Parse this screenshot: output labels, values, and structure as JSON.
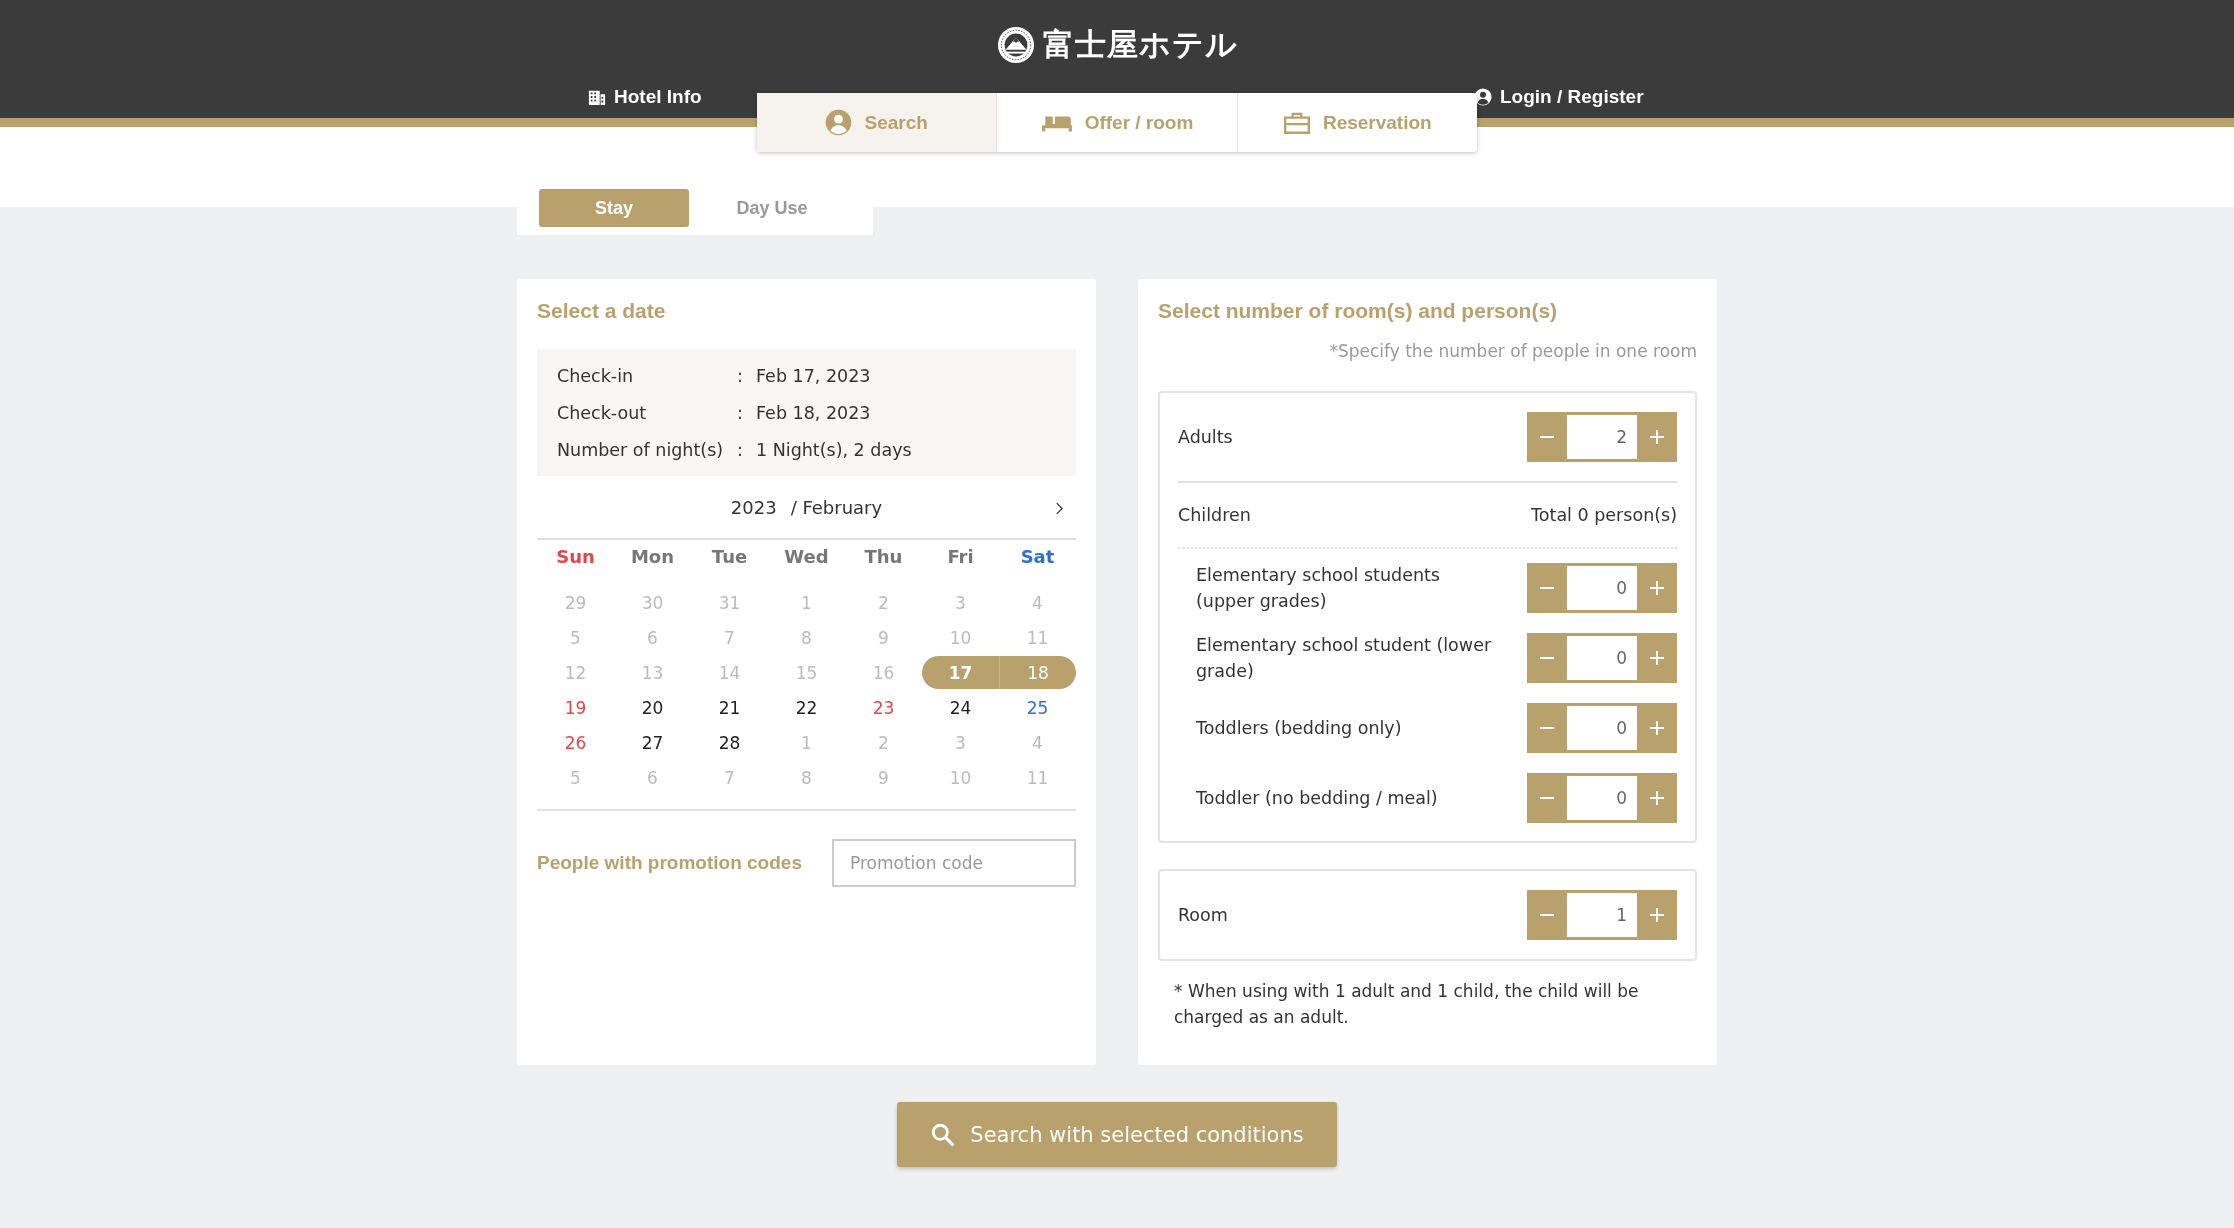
{
  "header": {
    "brand": "富士屋ホテル",
    "hotel_info": "Hotel Info",
    "login": "Login / Register"
  },
  "steps": [
    {
      "label": "Search",
      "selected": true
    },
    {
      "label": "Offer / room",
      "selected": false
    },
    {
      "label": "Reservation",
      "selected": false
    }
  ],
  "mode_tabs": [
    {
      "label": "Stay",
      "selected": true
    },
    {
      "label": "Day Use",
      "selected": false
    }
  ],
  "date_panel": {
    "title": "Select a date",
    "summary": [
      {
        "label": "Check-in",
        "value": "Feb 17, 2023"
      },
      {
        "label": "Check-out",
        "value": "Feb 18, 2023"
      },
      {
        "label": "Number of night(s)",
        "value": "1 Night(s), 2 days"
      }
    ],
    "separator": ":",
    "year": "2023",
    "month": "/ February",
    "weekdays": [
      {
        "label": "Sun",
        "kind": "red"
      },
      {
        "label": "Mon",
        "kind": "plain"
      },
      {
        "label": "Tue",
        "kind": "plain"
      },
      {
        "label": "Wed",
        "kind": "plain"
      },
      {
        "label": "Thu",
        "kind": "plain"
      },
      {
        "label": "Fri",
        "kind": "plain"
      },
      {
        "label": "Sat",
        "kind": "blue"
      }
    ],
    "weeks": [
      [
        {
          "label": "29",
          "kind": "muted",
          "selected": false
        },
        {
          "label": "30",
          "kind": "muted",
          "selected": false
        },
        {
          "label": "31",
          "kind": "muted",
          "selected": false
        },
        {
          "label": "1",
          "kind": "muted",
          "selected": false
        },
        {
          "label": "2",
          "kind": "muted",
          "selected": false
        },
        {
          "label": "3",
          "kind": "muted",
          "selected": false
        },
        {
          "label": "4",
          "kind": "muted",
          "selected": false
        }
      ],
      [
        {
          "label": "5",
          "kind": "muted",
          "selected": false
        },
        {
          "label": "6",
          "kind": "muted",
          "selected": false
        },
        {
          "label": "7",
          "kind": "muted",
          "selected": false
        },
        {
          "label": "8",
          "kind": "muted",
          "selected": false
        },
        {
          "label": "9",
          "kind": "muted",
          "selected": false
        },
        {
          "label": "10",
          "kind": "muted",
          "selected": false
        },
        {
          "label": "11",
          "kind": "muted",
          "selected": false
        }
      ],
      [
        {
          "label": "12",
          "kind": "muted",
          "selected": false
        },
        {
          "label": "13",
          "kind": "muted",
          "selected": false
        },
        {
          "label": "14",
          "kind": "muted",
          "selected": false
        },
        {
          "label": "15",
          "kind": "muted",
          "selected": false
        },
        {
          "label": "16",
          "kind": "muted",
          "selected": false
        },
        {
          "label": "17",
          "kind": "plain",
          "selected": true
        },
        {
          "label": "18",
          "kind": "blue",
          "selected": true
        }
      ],
      [
        {
          "label": "19",
          "kind": "red",
          "selected": false
        },
        {
          "label": "20",
          "kind": "plain",
          "selected": false
        },
        {
          "label": "21",
          "kind": "plain",
          "selected": false
        },
        {
          "label": "22",
          "kind": "plain",
          "selected": false
        },
        {
          "label": "23",
          "kind": "red",
          "selected": false
        },
        {
          "label": "24",
          "kind": "plain",
          "selected": false
        },
        {
          "label": "25",
          "kind": "blue",
          "selected": false
        }
      ],
      [
        {
          "label": "26",
          "kind": "red",
          "selected": false
        },
        {
          "label": "27",
          "kind": "plain",
          "selected": false
        },
        {
          "label": "28",
          "kind": "plain",
          "selected": false
        },
        {
          "label": "1",
          "kind": "muted",
          "selected": false
        },
        {
          "label": "2",
          "kind": "muted",
          "selected": false
        },
        {
          "label": "3",
          "kind": "muted",
          "selected": false
        },
        {
          "label": "4",
          "kind": "muted",
          "selected": false
        }
      ],
      [
        {
          "label": "5",
          "kind": "muted",
          "selected": false
        },
        {
          "label": "6",
          "kind": "muted",
          "selected": false
        },
        {
          "label": "7",
          "kind": "muted",
          "selected": false
        },
        {
          "label": "8",
          "kind": "muted",
          "selected": false
        },
        {
          "label": "9",
          "kind": "muted",
          "selected": false
        },
        {
          "label": "10",
          "kind": "muted",
          "selected": false
        },
        {
          "label": "11",
          "kind": "muted",
          "selected": false
        }
      ]
    ],
    "promo_label": "People with promotion codes",
    "promo_placeholder": "Promotion code"
  },
  "guest_panel": {
    "title": "Select number of room(s) and person(s)",
    "note": "*Specify the number of people in one room",
    "adults": {
      "label": "Adults",
      "value": "2"
    },
    "children": {
      "label": "Children",
      "total": "Total 0 person(s)",
      "items": [
        {
          "label": "Elementary school students (upper grades)",
          "value": "0"
        },
        {
          "label": "Elementary school student (lower grade)",
          "value": "0"
        },
        {
          "label": "Toddlers (bedding only)",
          "value": "0"
        },
        {
          "label": "Toddler (no bedding / meal)",
          "value": "0"
        }
      ]
    },
    "room": {
      "label": "Room",
      "value": "1"
    },
    "footnote": "* When using with 1 adult and 1 child, the child will be charged as an adult."
  },
  "search_button": "Search with selected conditions"
}
